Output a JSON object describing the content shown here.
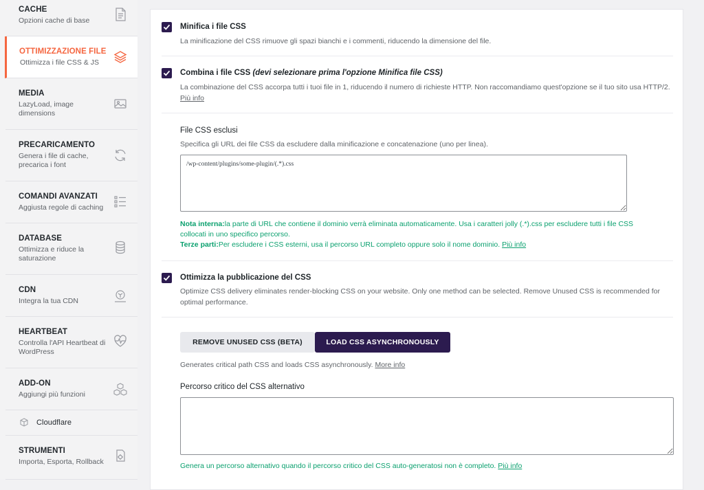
{
  "sidebar": {
    "items": [
      {
        "title": "CACHE",
        "desc": "Opzioni cache di base",
        "icon": "document-icon"
      },
      {
        "title": "OTTIMIZZAZIONE FILE",
        "desc": "Ottimizza i file CSS & JS",
        "icon": "layers-icon"
      },
      {
        "title": "MEDIA",
        "desc": "LazyLoad, image dimensions",
        "icon": "image-icon"
      },
      {
        "title": "PRECARICAMENTO",
        "desc": "Genera i file di cache, precarica i font",
        "icon": "refresh-icon"
      },
      {
        "title": "COMANDI AVANZATI",
        "desc": "Aggiusta regole di caching",
        "icon": "list-icon"
      },
      {
        "title": "DATABASE",
        "desc": "Ottimizza e riduce la saturazione",
        "icon": "database-icon"
      },
      {
        "title": "CDN",
        "desc": "Integra la tua CDN",
        "icon": "cdn-icon"
      },
      {
        "title": "HEARTBEAT",
        "desc": "Controlla l'API Heartbeat di WordPress",
        "icon": "heartbeat-icon"
      },
      {
        "title": "ADD-ON",
        "desc": "Aggiungi più funzioni",
        "icon": "cubes-icon"
      },
      {
        "title": "Cloudflare",
        "desc": "",
        "icon": "cube-icon"
      },
      {
        "title": "STRUMENTI",
        "desc": "Importa, Esporta, Rollback",
        "icon": "tools-icon"
      }
    ]
  },
  "options": {
    "minify": {
      "checked": true,
      "title": "Minifica i file CSS",
      "desc": "La minificazione del CSS rimuove gli spazi bianchi e i commenti, riducendo la dimensione del file."
    },
    "combine": {
      "checked": true,
      "title": "Combina i file CSS",
      "title_note": "(devi selezionare prima l'opzione Minifica file CSS)",
      "desc": "La combinazione del CSS accorpa tutti i tuoi file in 1, riducendo il numero di richieste HTTP. Non raccomandiamo quest'opzione se il tuo sito usa HTTP/2.",
      "more": "Più info"
    },
    "excluded": {
      "label": "File CSS esclusi",
      "desc": "Specifica gli URL dei file CSS da escludere dalla minificazione e concatenazione (uno per linea).",
      "value": "/wp-content/plugins/some-plugin/(.*).css",
      "note_label": "Nota interna:",
      "note_text": "la parte di URL che contiene il dominio verrà eliminata automaticamente. Usa i caratteri jolly (.*).css per escludere tutti i file CSS collocati in uno specifico percorso.",
      "third_label": "Terze parti:",
      "third_text": "Per escludere i CSS esterni, usa il percorso URL completo oppure solo il nome dominio.",
      "third_more": "Più info"
    },
    "delivery": {
      "checked": true,
      "title": "Ottimizza la pubblicazione del CSS",
      "desc": "Optimize CSS delivery eliminates render-blocking CSS on your website. Only one method can be selected. Remove Unused CSS is recommended for optimal performance.",
      "tab_remove": "REMOVE UNUSED CSS (BETA)",
      "tab_load": "LOAD CSS ASYNCHRONOUSLY",
      "active_tab": "LOAD CSS ASYNCHRONOUSLY",
      "async_desc": "Generates critical path CSS and loads CSS asynchronously.",
      "async_more": "More info",
      "critical_label": "Percorso critico del CSS alternativo",
      "critical_value": "",
      "critical_note": "Genera un percorso alternativo quando il percorso critico del CSS auto-generatosi non è completo.",
      "critical_more": "Più info"
    }
  },
  "colors": {
    "accent": "#f56640",
    "brand": "#2c1b4f",
    "note_green": "#0aa06e"
  }
}
